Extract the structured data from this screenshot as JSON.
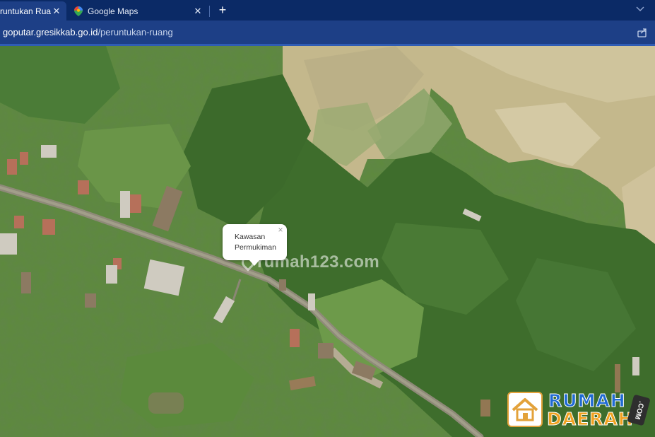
{
  "browser": {
    "tabs": [
      {
        "title": "runtukan Ruan",
        "active": true
      },
      {
        "title": "Google Maps",
        "active": false
      }
    ],
    "new_tab_label": "+",
    "close_glyph": "✕",
    "address": {
      "host": "goputar.gresikkab.go.id",
      "path": "/peruntukan-ruang"
    },
    "icons": [
      "google-maps-favicon",
      "tab-close-icon",
      "plus-icon",
      "chevron-down-icon",
      "share-icon"
    ]
  },
  "map": {
    "type": "satellite",
    "popup": {
      "line1": "Kawasan",
      "line2": "Permukiman",
      "close_glyph": "×"
    }
  },
  "watermarks": {
    "rumah123": "rumah123.com",
    "rumahdaerah_line1": "RUMAH",
    "rumahdaerah_line2": "DAERAH",
    "rumahdaerah_suffix": ".COM"
  },
  "colors": {
    "tabbar": "#0b2a66",
    "addressbar": "#1d3f86",
    "vegetation": "#5f8a3e",
    "bare_land": "#c6b98e",
    "road": "#8c8878"
  }
}
